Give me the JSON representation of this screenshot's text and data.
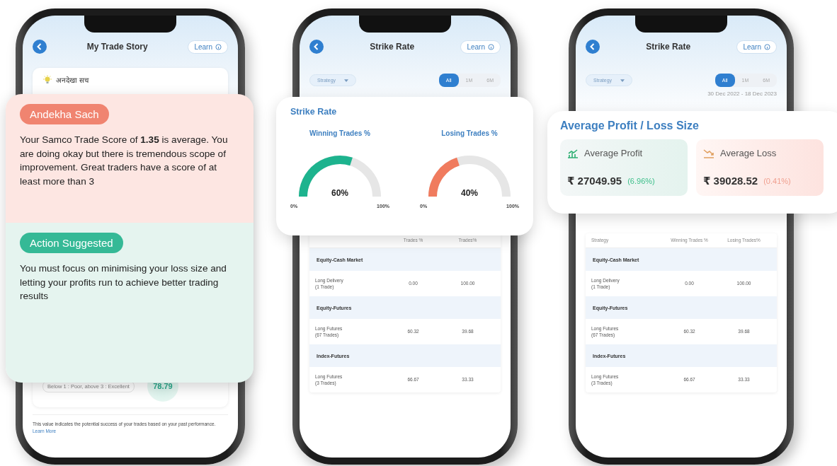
{
  "trade_story_screen": {
    "title": "My Trade Story",
    "learn_button": "Learn",
    "insight_label": "अनदेखा सच",
    "score_legend": "Below 1 : Poor, above 3 : Excellent",
    "score": "78.79",
    "footnote": "This value indicates the potential success of your trades based on your past performance.",
    "footnote_link": "Learn More"
  },
  "insight_card": {
    "problem_badge": "Andekha Sach",
    "problem_text": "Your Samco Trade Score of **1.35** is average. You are doing okay but there is tremendous scope of improvement. Great traders have a score of at least more than 3",
    "action_badge": "Action Suggested",
    "action_text": "You must focus on minimising your loss size and letting your profits run to achieve better trading results"
  },
  "strike_rate_screens": [
    {
      "title": "Strike Rate",
      "learn_button": "Learn",
      "filter": "Strategy",
      "periods": [
        {
          "label": "All",
          "selected": true
        },
        {
          "label": "1M",
          "selected": false
        },
        {
          "label": "6M",
          "selected": false
        }
      ],
      "table": {
        "columns": [
          "Trades %",
          "Trades%"
        ],
        "rows": [
          {
            "kind": "group",
            "label": "Equity-Cash Market"
          },
          {
            "kind": "row",
            "strategy": "Long Delivery",
            "trades": "(1 Trade)",
            "winning": "0.00",
            "losing": "100.00"
          },
          {
            "kind": "group",
            "label": "Equity-Futures"
          },
          {
            "kind": "row",
            "strategy": "Long Futures",
            "trades": "(67 Trades)",
            "winning": "60.32",
            "losing": "39.68"
          },
          {
            "kind": "group",
            "label": "Index-Futures"
          },
          {
            "kind": "row",
            "strategy": "Long Futures",
            "trades": "(3 Trades)",
            "winning": "66.67",
            "losing": "33.33"
          }
        ]
      }
    },
    {
      "title": "Strike Rate",
      "learn_button": "Learn",
      "filter": "Strategy",
      "periods": [
        {
          "label": "All",
          "selected": true
        },
        {
          "label": "1M",
          "selected": false
        },
        {
          "label": "6M",
          "selected": false
        }
      ],
      "date_range": "30 Dec 2022 - 18 Dec 2023",
      "table": {
        "columns": [
          "Strategy",
          "Winning Trades %",
          "Losing Trades%"
        ],
        "rows": [
          {
            "kind": "group",
            "label": "Equity-Cash Market"
          },
          {
            "kind": "row",
            "strategy": "Long Delivery",
            "trades": "(1 Trade)",
            "winning": "0.00",
            "losing": "100.00"
          },
          {
            "kind": "group",
            "label": "Equity-Futures"
          },
          {
            "kind": "row",
            "strategy": "Long Futures",
            "trades": "(67 Trades)",
            "winning": "60.32",
            "losing": "39.68"
          },
          {
            "kind": "group",
            "label": "Index-Futures"
          },
          {
            "kind": "row",
            "strategy": "Long Futures",
            "trades": "(3 Trades)",
            "winning": "66.67",
            "losing": "33.33"
          }
        ]
      }
    }
  ],
  "strike_rate_card": {
    "title": "Strike Rate",
    "gauges": [
      {
        "label": "Winning Trades %",
        "level": 0.6,
        "reading": "60%",
        "min": "0%",
        "max": "100%",
        "color": "#1db38e"
      },
      {
        "label": "Losing Trades %",
        "level": 0.4,
        "reading": "40%",
        "min": "0%",
        "max": "100%",
        "color": "#f07b5e"
      }
    ]
  },
  "profit_loss_card": {
    "title": "Average Profit / Loss Size",
    "tiles": [
      {
        "kind": "profit",
        "label": "Average Profit",
        "value": "₹ 27049.95",
        "change": "(6.96%)"
      },
      {
        "kind": "loss",
        "label": "Average Loss",
        "value": "₹ 39028.52",
        "change": "(0.41%)"
      }
    ]
  }
}
